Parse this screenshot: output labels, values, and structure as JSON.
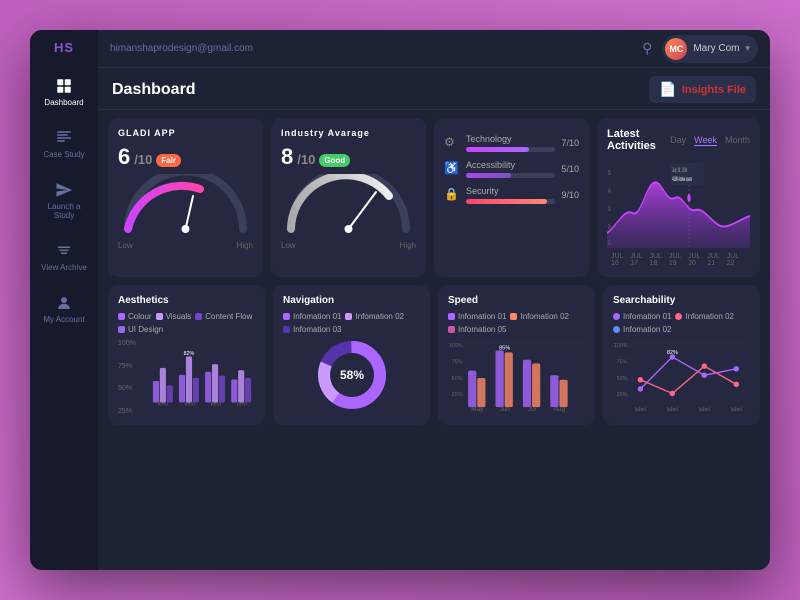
{
  "app": {
    "logo": "HS",
    "email": "himanshaprodesign@gmail.com"
  },
  "sidebar": {
    "items": [
      {
        "label": "Dashboard",
        "icon": "dashboard",
        "active": true
      },
      {
        "label": "Case Study",
        "icon": "case-study",
        "active": false
      },
      {
        "label": "Launch a Study",
        "icon": "launch",
        "active": false
      },
      {
        "label": "View Archive",
        "icon": "archive",
        "active": false
      },
      {
        "label": "My Account",
        "icon": "account",
        "active": false
      }
    ]
  },
  "topbar": {
    "email": "himanshaprodesign@gmail.com",
    "user": {
      "name": "Mary Com",
      "initials": "MC"
    }
  },
  "page": {
    "title": "Dashboard",
    "insights_btn": "Insights File"
  },
  "gladi_app": {
    "title": "GLADI APP",
    "value": "6",
    "denom": "/10",
    "badge": "Fair",
    "low": "Low",
    "high": "High",
    "score": 6
  },
  "industry_avg": {
    "title": "Industry Avarage",
    "value": "8",
    "denom": "/10",
    "badge": "Good",
    "low": "Low",
    "high": "High",
    "score": 8
  },
  "metrics": [
    {
      "name": "Technology",
      "score": "7/10",
      "value": 70,
      "color": "#aa66ff"
    },
    {
      "name": "Accessibility",
      "score": "5/10",
      "value": 50,
      "color": "#7755ee"
    },
    {
      "name": "Security",
      "score": "9/10",
      "value": 90,
      "color": "#ff6677"
    }
  ],
  "activities": {
    "title": "Latest Activities",
    "tabs": [
      "Day",
      "Week",
      "Month"
    ],
    "active_tab": "Week",
    "tooltip": {
      "date": "July 19, 2016",
      "value": "4180 Active users"
    },
    "x_labels": [
      "JUL 16",
      "JUL 17",
      "JUL 18",
      "JUL 19",
      "JUL 20",
      "JUL 21",
      "JUL 22"
    ],
    "y_labels": [
      "1k",
      "2k",
      "3k",
      "4k",
      "5k"
    ]
  },
  "bottom_cards": [
    {
      "title": "Aesthetics",
      "type": "bar",
      "legend": [
        {
          "label": "Colour",
          "color": "#aa66ff"
        },
        {
          "label": "Visuals",
          "color": "#cc88ff"
        },
        {
          "label": "Content Flow",
          "color": "#7744cc"
        },
        {
          "label": "UI Design",
          "color": "#9966ee"
        }
      ],
      "bars": [
        {
          "items": [
            55,
            70,
            45
          ],
          "label": "Item"
        },
        {
          "items": [
            60,
            82,
            50
          ],
          "label": "Item",
          "peak": 82
        },
        {
          "items": [
            65,
            55,
            70
          ],
          "label": "Item"
        },
        {
          "items": [
            50,
            60,
            55
          ],
          "label": "Item"
        }
      ],
      "y_labels": [
        "100%",
        "75%",
        "50%",
        "25%"
      ]
    },
    {
      "title": "Navigation",
      "type": "donut",
      "legend": [
        {
          "label": "Infomation 01",
          "color": "#aa66ff"
        },
        {
          "label": "Infomation 02",
          "color": "#cc99ff"
        },
        {
          "label": "Infomation 03",
          "color": "#5533aa"
        }
      ],
      "value": "58%",
      "segments": [
        58,
        22,
        20
      ]
    },
    {
      "title": "Speed",
      "type": "grouped_bar",
      "legend": [
        {
          "label": "Infomation 01",
          "color": "#aa66ff"
        },
        {
          "label": "Infomation 02",
          "color": "#ff8866"
        },
        {
          "label": "Infomation 05",
          "color": "#cc55aa"
        }
      ],
      "x_labels": [
        "May",
        "Jun",
        "Jul",
        "Aug"
      ],
      "y_labels": [
        "100%",
        "75%",
        "50%",
        "25%"
      ],
      "bars": [
        {
          "values": [
            60,
            40
          ],
          "label": "May"
        },
        {
          "values": [
            80,
            85
          ],
          "label": "Jun",
          "peak": 85
        },
        {
          "values": [
            70,
            65
          ],
          "label": "Jul"
        },
        {
          "values": [
            55,
            50
          ],
          "label": "Aug"
        }
      ]
    },
    {
      "title": "Searchability",
      "type": "line",
      "legend": [
        {
          "label": "Infomation 01",
          "color": "#aa66ff"
        },
        {
          "label": "Infomation 02",
          "color": "#ff6688"
        },
        {
          "label": "Infomation 02",
          "color": "#6688ff"
        }
      ],
      "x_labels": [
        "label",
        "label",
        "label",
        "label"
      ],
      "y_labels": [
        "100%",
        "75%",
        "50%",
        "25%"
      ],
      "peak": "82%"
    }
  ]
}
